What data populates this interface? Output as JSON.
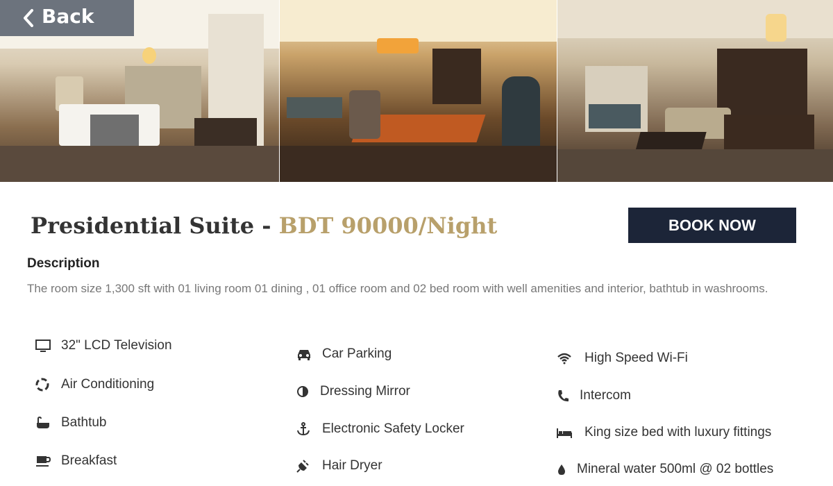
{
  "nav": {
    "back_label": "Back"
  },
  "room": {
    "name": "Presidential Suite - ",
    "price": "BDT 90000/Night",
    "book_label": "BOOK NOW",
    "description_heading": "Description",
    "description": "The room size 1,300 sft with 01 living room 01 dining , 01 office room and 02 bed room with well amenities and interior, bathtub in washrooms."
  },
  "gallery": [
    {
      "subject": "bedroom-photo"
    },
    {
      "subject": "dining-room-photo"
    },
    {
      "subject": "living-room-photo"
    }
  ],
  "amenities": {
    "col1": [
      {
        "label": "32\" LCD Television",
        "icon": "tv-icon"
      },
      {
        "label": "Air Conditioning",
        "icon": "recycle-icon"
      },
      {
        "label": "Bathtub",
        "icon": "bathtub-icon"
      },
      {
        "label": "Breakfast",
        "icon": "coffee-icon"
      }
    ],
    "col2": [
      {
        "label": "Car Parking",
        "icon": "car-icon"
      },
      {
        "label": "Dressing Mirror",
        "icon": "half-circle-icon"
      },
      {
        "label": "Electronic Safety Locker",
        "icon": "anchor-icon"
      },
      {
        "label": "Hair Dryer",
        "icon": "plug-icon"
      }
    ],
    "col3": [
      {
        "label": "High Speed Wi-Fi",
        "icon": "wifi-icon"
      },
      {
        "label": "Intercom",
        "icon": "phone-icon"
      },
      {
        "label": "King size bed with luxury fittings",
        "icon": "bed-icon"
      },
      {
        "label": "Mineral water 500ml @ 02 bottles",
        "icon": "drop-icon"
      }
    ]
  }
}
